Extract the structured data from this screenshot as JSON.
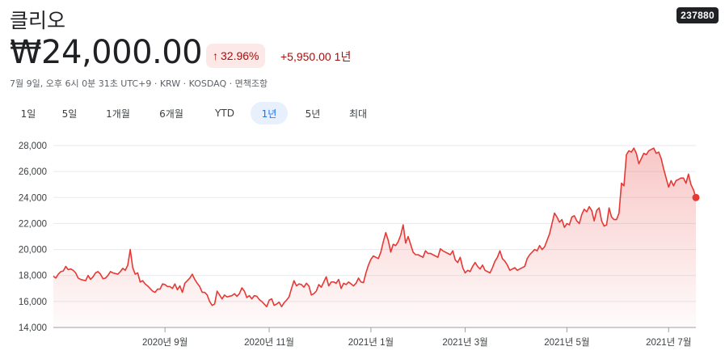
{
  "header": {
    "title": "클리오",
    "ticker": "237880"
  },
  "quote": {
    "price": "₩24,000.00",
    "change_pct": "32.96%",
    "change_direction": "up",
    "change_abs": "+5,950.00",
    "change_period": "1년",
    "meta": "7월 9일, 오후 6시 0분 31초 UTC+9 · KRW · KOSDAQ · 면책조항"
  },
  "range_tabs": [
    {
      "label": "1일",
      "active": false
    },
    {
      "label": "5일",
      "active": false
    },
    {
      "label": "1개월",
      "active": false
    },
    {
      "label": "6개월",
      "active": false
    },
    {
      "label": "YTD",
      "active": false
    },
    {
      "label": "1년",
      "active": true
    },
    {
      "label": "5년",
      "active": false
    },
    {
      "label": "최대",
      "active": false
    }
  ],
  "colors": {
    "line": "#e53935",
    "fill": "#fce8e6",
    "accent": "#1a73e8",
    "negative_text": "#a50e0e"
  },
  "chart_data": {
    "type": "area",
    "ylim": [
      14000,
      28000
    ],
    "y_ticks": [
      "28,000",
      "26,000",
      "24,000",
      "22,000",
      "20,000",
      "18,000",
      "16,000",
      "14,000"
    ],
    "x_ticks": [
      {
        "label": "2020년 9월",
        "index": 45
      },
      {
        "label": "2020년 11월",
        "index": 87
      },
      {
        "label": "2021년 1월",
        "index": 128
      },
      {
        "label": "2021년 3월",
        "index": 166
      },
      {
        "label": "2021년 5월",
        "index": 207
      },
      {
        "label": "2021년 7월",
        "index": 248
      }
    ],
    "grid": true,
    "series": [
      {
        "values": [
          17950,
          17800,
          18100,
          18300,
          18350,
          18700,
          18450,
          18500,
          18400,
          18200,
          17800,
          17700,
          17650,
          17600,
          18000,
          17700,
          17900,
          18200,
          18300,
          18100,
          17750,
          17800,
          18000,
          18300,
          18200,
          18150,
          18100,
          18300,
          18550,
          18400,
          18800,
          20000,
          18600,
          18100,
          18200,
          17500,
          17600,
          17350,
          17200,
          17000,
          16800,
          16700,
          16950,
          16950,
          17350,
          17300,
          17150,
          17150,
          17000,
          17350,
          16900,
          17200,
          16700,
          17400,
          17600,
          17800,
          18100,
          17700,
          17400,
          17150,
          16700,
          16700,
          16500,
          16000,
          15700,
          15800,
          16800,
          16500,
          16200,
          16500,
          16350,
          16400,
          16450,
          16600,
          16400,
          16600,
          17050,
          16800,
          16300,
          16450,
          16200,
          16450,
          16400,
          16150,
          16000,
          15800,
          15600,
          16100,
          16200,
          15700,
          15800,
          15950,
          15600,
          15900,
          16100,
          16350,
          17000,
          17600,
          17200,
          17350,
          17300,
          17100,
          17400,
          17200,
          16500,
          16600,
          16800,
          17300,
          17100,
          17500,
          17900,
          17200,
          17500,
          17500,
          17400,
          17700,
          17000,
          17400,
          17300,
          17500,
          17350,
          17200,
          17400,
          17800,
          17500,
          17450,
          18200,
          18800,
          19250,
          19500,
          19400,
          19300,
          19800,
          20600,
          21300,
          20700,
          19800,
          20400,
          20300,
          20600,
          21100,
          21900,
          20500,
          21000,
          20400,
          19800,
          19600,
          19600,
          19500,
          19400,
          19900,
          19700,
          19700,
          19600,
          19500,
          19400,
          20050,
          19900,
          19800,
          19700,
          19600,
          19900,
          19200,
          19000,
          19400,
          18600,
          18200,
          18400,
          18300,
          18700,
          19000,
          18700,
          18500,
          18800,
          18400,
          18300,
          18200,
          18600,
          19100,
          19400,
          19900,
          19300,
          19100,
          18800,
          18400,
          18500,
          18600,
          18400,
          18500,
          18600,
          18700,
          19300,
          19600,
          19800,
          20000,
          19900,
          20300,
          20000,
          20200,
          20700,
          21200,
          22000,
          22800,
          22500,
          22100,
          22300,
          21700,
          22000,
          21900,
          22500,
          22600,
          22200,
          22000,
          22700,
          23100,
          22900,
          23300,
          23000,
          22200,
          23000,
          23200,
          22200,
          21800,
          21900,
          23200,
          22500,
          22300,
          22300,
          22800,
          25100,
          24900,
          27300,
          27600,
          27500,
          27800,
          27400,
          26600,
          27000,
          27400,
          27300,
          27600,
          27700,
          27800,
          27400,
          27500,
          27000,
          26200,
          25500,
          24800,
          25300,
          24900,
          25300,
          25400,
          25500,
          25500,
          25100,
          25800,
          25000,
          24600,
          24000
        ]
      }
    ]
  }
}
